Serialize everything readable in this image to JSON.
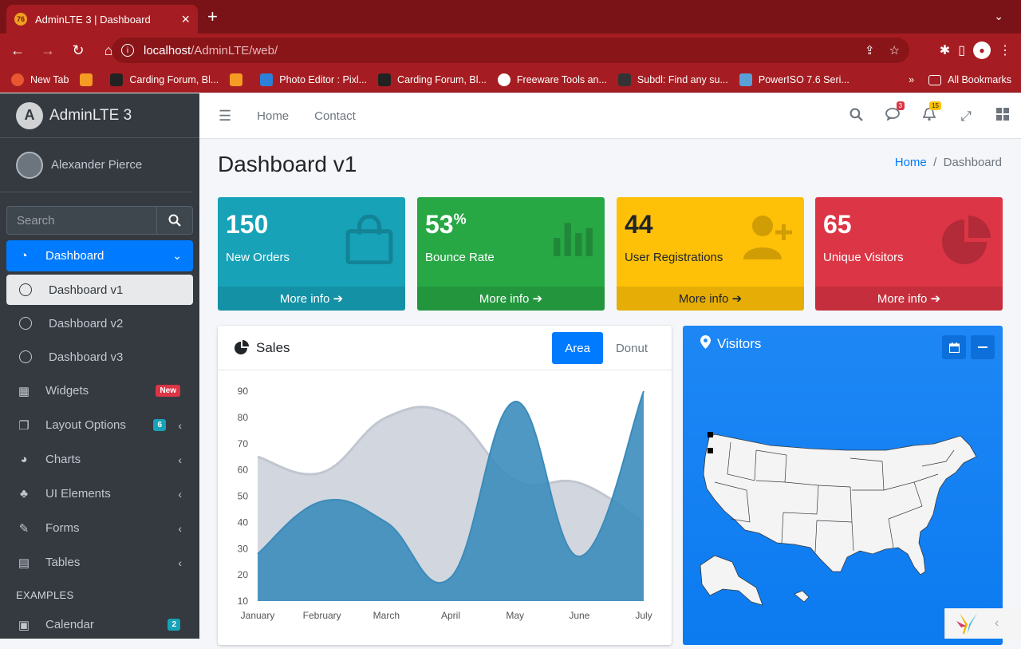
{
  "browser": {
    "tab_title": "AdminLTE 3 | Dashboard",
    "url_host": "localhost",
    "url_path": "/AdminLTE/web/",
    "bookmarks": [
      "New Tab",
      "Carding Forum, Bl...",
      "Photo Editor : Pixl...",
      "Carding Forum, Bl...",
      "Freeware Tools an...",
      "Subdl: Find any su...",
      "PowerISO 7.6 Seri..."
    ],
    "all_bookmarks": "All Bookmarks"
  },
  "sidebar": {
    "brand": "AdminLTE 3",
    "user": "Alexander Pierce",
    "search_placeholder": "Search",
    "items": [
      {
        "label": "Dashboard"
      },
      {
        "label": "Dashboard v1"
      },
      {
        "label": "Dashboard v2"
      },
      {
        "label": "Dashboard v3"
      },
      {
        "label": "Widgets",
        "badge": "New"
      },
      {
        "label": "Layout Options",
        "badge": "6"
      },
      {
        "label": "Charts"
      },
      {
        "label": "UI Elements"
      },
      {
        "label": "Forms"
      },
      {
        "label": "Tables"
      }
    ],
    "header": "EXAMPLES",
    "calendar": {
      "label": "Calendar",
      "badge": "2"
    }
  },
  "topnav": {
    "home": "Home",
    "contact": "Contact",
    "messages_count": "3",
    "notifications_count": "15"
  },
  "page": {
    "title": "Dashboard v1",
    "breadcrumb_home": "Home",
    "breadcrumb_current": "Dashboard"
  },
  "boxes": [
    {
      "value": "150",
      "label": "New Orders",
      "more": "More info"
    },
    {
      "value": "53",
      "suffix": "%",
      "label": "Bounce Rate",
      "more": "More info"
    },
    {
      "value": "44",
      "label": "User Registrations",
      "more": "More info"
    },
    {
      "value": "65",
      "label": "Unique Visitors",
      "more": "More info"
    }
  ],
  "sales": {
    "title": "Sales",
    "tab_area": "Area",
    "tab_donut": "Donut"
  },
  "visitors": {
    "title": "Visitors"
  },
  "chart_data": {
    "type": "area",
    "categories": [
      "January",
      "February",
      "March",
      "April",
      "May",
      "June",
      "July"
    ],
    "ylim": [
      10,
      90
    ],
    "yticks": [
      10,
      20,
      30,
      40,
      50,
      60,
      70,
      80,
      90
    ],
    "series": [
      {
        "values": [
          65,
          59,
          80,
          81,
          56,
          55,
          40
        ],
        "color": "#d2d6de"
      },
      {
        "values": [
          28,
          48,
          40,
          19,
          86,
          27,
          90
        ],
        "color": "#3c8dbc"
      }
    ]
  }
}
